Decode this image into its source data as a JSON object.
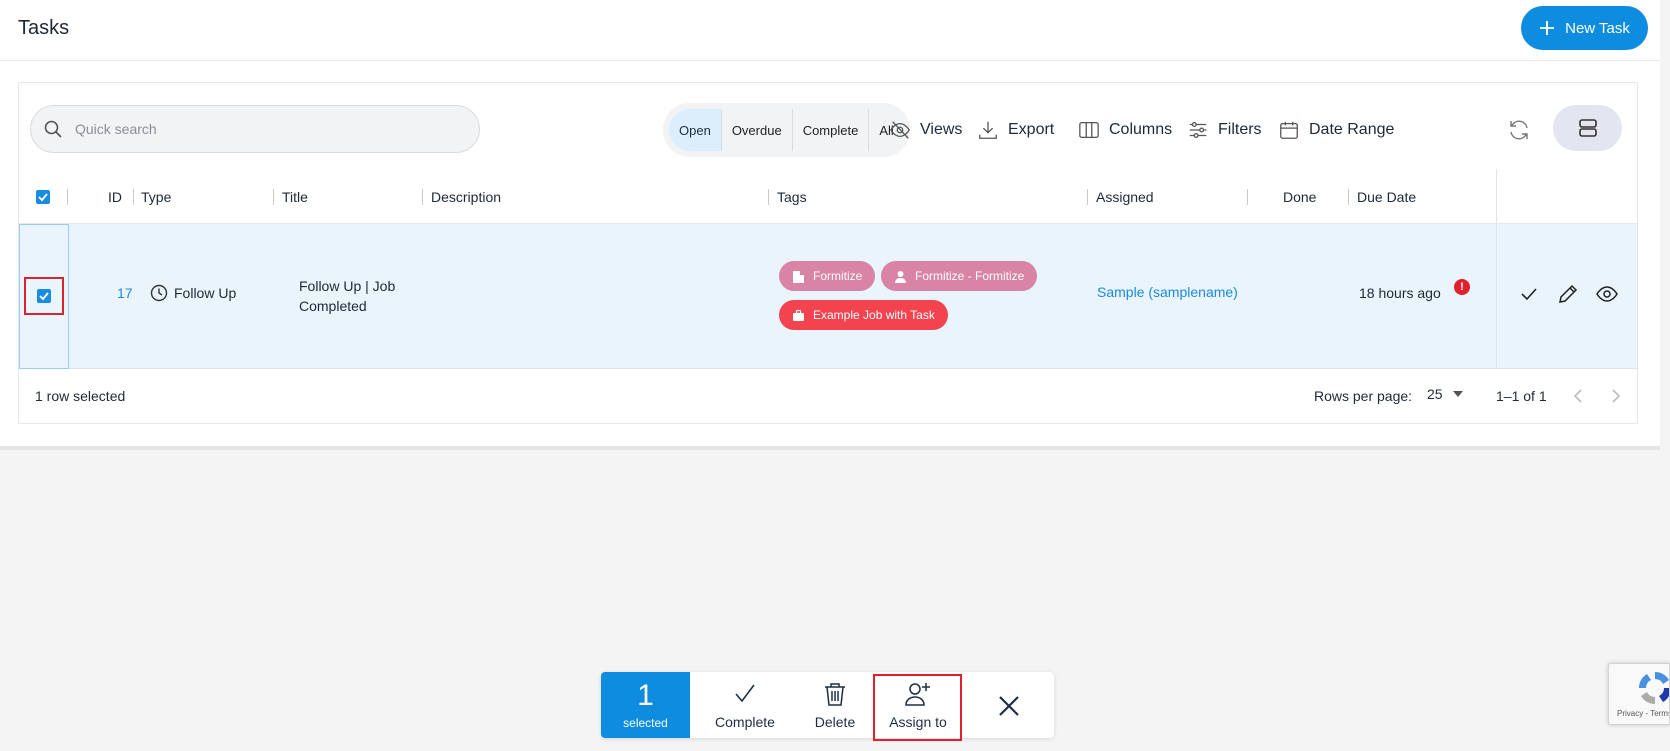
{
  "header": {
    "title": "Tasks",
    "new_task_label": "New Task"
  },
  "toolbar": {
    "search_placeholder": "Quick search",
    "filters": [
      {
        "label": "Open",
        "active": true
      },
      {
        "label": "Overdue",
        "active": false
      },
      {
        "label": "Complete",
        "active": false
      },
      {
        "label": "All",
        "active": false
      }
    ],
    "views_label": "Views",
    "export_label": "Export",
    "columns_label": "Columns",
    "filters_label": "Filters",
    "date_range_label": "Date Range"
  },
  "table": {
    "columns": [
      "ID",
      "Type",
      "Title",
      "Description",
      "Tags",
      "Assigned",
      "Done",
      "Due Date"
    ],
    "rows": [
      {
        "id": "17",
        "type": "Follow Up",
        "title": "Follow Up | Job Completed",
        "description": "",
        "tags": [
          {
            "label": "Formitize",
            "icon": "building-icon",
            "color": "#d983a5"
          },
          {
            "label": "Formitize - Formitize",
            "icon": "person-icon",
            "color": "#d983a5"
          },
          {
            "label": "Example Job with Task",
            "icon": "briefcase-icon",
            "color": "#f2434f"
          }
        ],
        "assigned": "Sample (samplename)",
        "done": "",
        "due": "18 hours ago",
        "overdue_marker": "!",
        "selected": true
      }
    ],
    "footer": {
      "selection_text": "1 row selected",
      "rows_per_page_label": "Rows per page:",
      "rows_per_page_value": "25",
      "range_text": "1–1 of 1"
    }
  },
  "bulk_actions": {
    "count": "1",
    "count_label": "selected",
    "complete_label": "Complete",
    "delete_label": "Delete",
    "assign_label": "Assign to"
  },
  "recaptcha": {
    "text": "Privacy - Terms"
  },
  "colors": {
    "primary": "#0e8de0",
    "highlight": "#e0202b",
    "selected_row": "#eaf4fd",
    "tag_pink": "#d983a5",
    "tag_red": "#f2434f"
  }
}
